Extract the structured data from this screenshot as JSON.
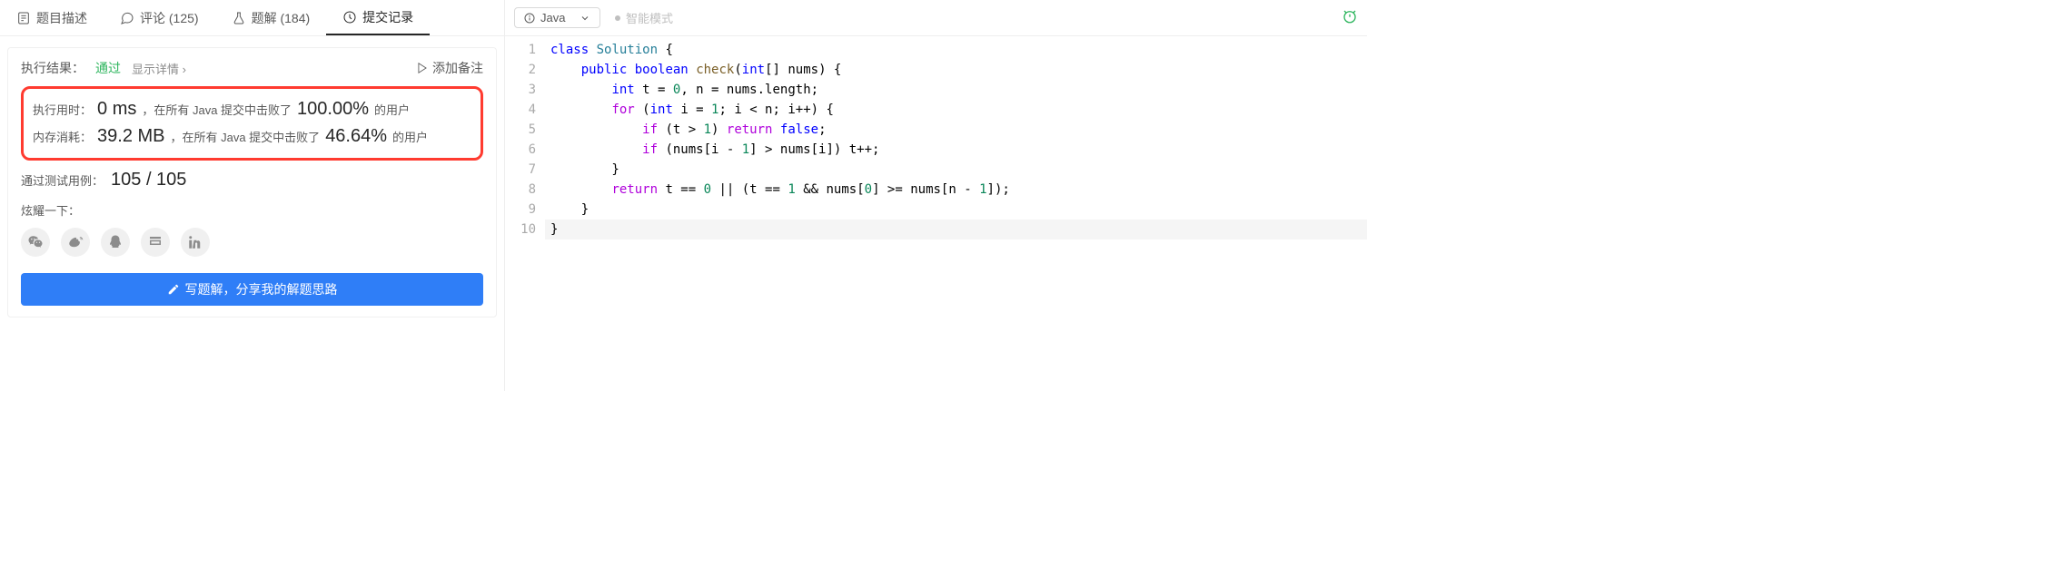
{
  "tabs": {
    "description": "题目描述",
    "comments": "评论 (125)",
    "solutions": "题解 (184)",
    "submissions": "提交记录"
  },
  "result": {
    "label": "执行结果：",
    "status": "通过",
    "show_details": "显示详情",
    "add_note": "添加备注",
    "runtime_label": "执行用时：",
    "runtime_value": "0 ms",
    "runtime_mid": "，在所有 Java 提交中击败了",
    "runtime_pct": "100.00%",
    "runtime_suffix": "的用户",
    "memory_label": "内存消耗：",
    "memory_value": "39.2 MB",
    "memory_mid": "，在所有 Java 提交中击败了",
    "memory_pct": "46.64%",
    "memory_suffix": "的用户",
    "testcases_label": "通过测试用例：",
    "testcases_value": "105 / 105",
    "share_label": "炫耀一下：",
    "write_solution": "写题解，分享我的解题思路"
  },
  "editor": {
    "lang": "Java",
    "smart_mode": "智能模式",
    "lines": [
      "class Solution {",
      "    public boolean check(int[] nums) {",
      "        int t = 0, n = nums.length;",
      "        for (int i = 1; i < n; i++) {",
      "            if (t > 1) return false;",
      "            if (nums[i - 1] > nums[i]) t++;",
      "        }",
      "        return t == 0 || (t == 1 && nums[0] >= nums[n - 1]);",
      "    }",
      "}"
    ]
  }
}
